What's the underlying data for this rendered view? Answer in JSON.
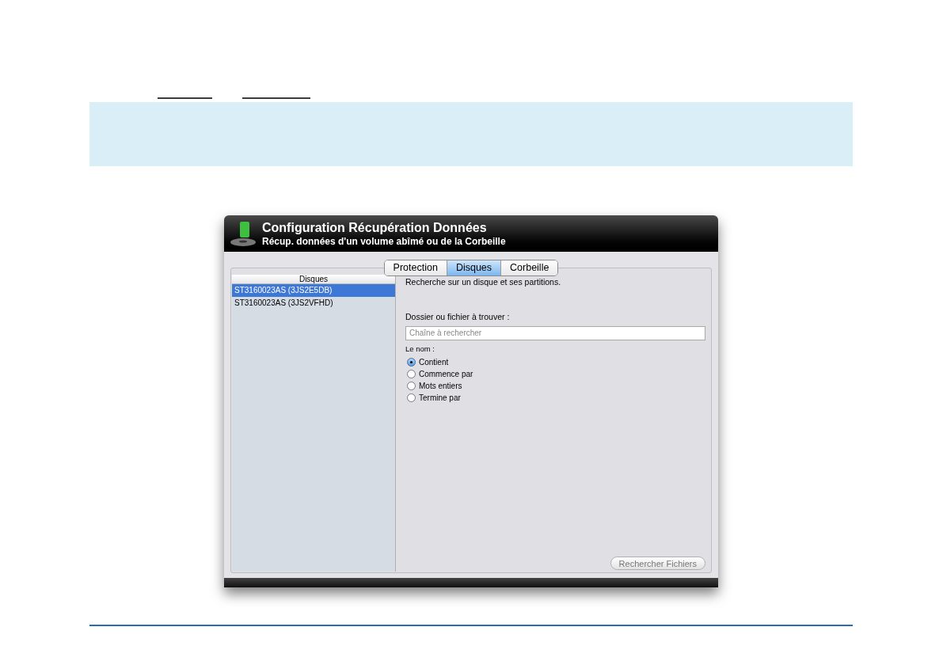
{
  "window": {
    "title": "Configuration Récupération Données",
    "subtitle": "Récup. données d'un volume abîmé ou de la Corbeille"
  },
  "tabs": [
    {
      "label": "Protection",
      "selected": false
    },
    {
      "label": "Disques",
      "selected": true
    },
    {
      "label": "Corbeille",
      "selected": false
    }
  ],
  "disk_list": {
    "header": "Disques",
    "items": [
      {
        "label": "ST3160023AS (3JS2E5DB)",
        "selected": true
      },
      {
        "label": "ST3160023AS (3JS2VFHD)",
        "selected": false
      }
    ]
  },
  "description": "Recherche sur un disque et ses partitions.",
  "search": {
    "label": "Dossier ou fichier à trouver :",
    "placeholder": "Chaîne à rechercher"
  },
  "name_options": {
    "label": "Le nom :",
    "options": [
      {
        "label": "Contient",
        "selected": true
      },
      {
        "label": "Commence par",
        "selected": false
      },
      {
        "label": "Mots entiers",
        "selected": false
      },
      {
        "label": "Termine par",
        "selected": false
      }
    ]
  },
  "search_button": {
    "label": "Rechercher Fichiers",
    "disabled": true
  }
}
